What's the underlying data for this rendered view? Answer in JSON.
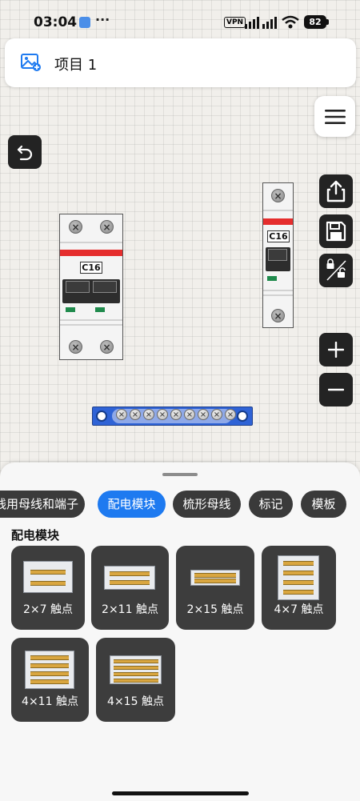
{
  "status_bar": {
    "time": "03:04",
    "dots": "···",
    "vpn": "VPN",
    "battery": "82"
  },
  "project": {
    "title": "项目 1",
    "icon": "image-add-icon"
  },
  "toolbar": {
    "menu_icon": "hamburger-menu-icon",
    "back_icon": "undo-icon",
    "share_icon": "share-icon",
    "save_icon": "save-icon",
    "lock_icon": "lock-unlock-icon",
    "zoom_in_icon": "plus-icon",
    "zoom_out_icon": "minus-icon"
  },
  "canvas": {
    "breaker_2p": {
      "rating": "C16"
    },
    "breaker_1p": {
      "rating": "C16"
    },
    "busbar": {
      "screw_count": 9
    }
  },
  "sheet": {
    "tabs": [
      {
        "label": "线用母线和端子",
        "active": false
      },
      {
        "label": "配电模块",
        "active": true
      },
      {
        "label": "梳形母线",
        "active": false
      },
      {
        "label": "标记",
        "active": false
      },
      {
        "label": "模板",
        "active": false
      }
    ],
    "section_title": "配电模块",
    "items": [
      {
        "label": "2×7 触点"
      },
      {
        "label": "2×11 触点"
      },
      {
        "label": "2×15 触点"
      },
      {
        "label": "4×7 触点"
      },
      {
        "label": "4×11 触点"
      },
      {
        "label": "4×15 触点"
      }
    ]
  },
  "colors": {
    "accent": "#1e7af0",
    "dark_button": "#232323",
    "breaker_band": "#e52d2d",
    "busbar": "#2f63d6"
  }
}
